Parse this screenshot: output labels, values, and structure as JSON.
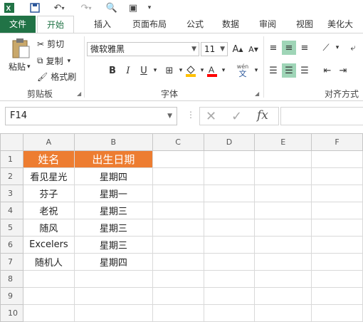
{
  "colors": {
    "accent": "#217346",
    "header_fill": "#ed7d31"
  },
  "tabs": [
    {
      "label": "文件"
    },
    {
      "label": "开始"
    },
    {
      "label": "插入"
    },
    {
      "label": "页面布局"
    },
    {
      "label": "公式"
    },
    {
      "label": "数据"
    },
    {
      "label": "审阅"
    },
    {
      "label": "视图"
    },
    {
      "label": "美化大"
    }
  ],
  "ribbon": {
    "clipboard": {
      "paste": "粘贴",
      "cut": "剪切",
      "copy": "复制",
      "format_painter": "格式刷",
      "group_label": "剪贴板"
    },
    "font": {
      "font_name": "微软雅黑",
      "font_size": "11",
      "bold": "B",
      "italic": "I",
      "underline": "U",
      "wen": "wén",
      "wen_char": "文",
      "group_label": "字体"
    },
    "alignment": {
      "group_label": "对齐方式"
    }
  },
  "formula_bar": {
    "name_box": "F14",
    "fx": "fx",
    "formula": ""
  },
  "sheet": {
    "columns": [
      "A",
      "B",
      "C",
      "D",
      "E",
      "F"
    ],
    "rows": [
      {
        "num": "1",
        "cells": [
          "姓名",
          "出生日期"
        ]
      },
      {
        "num": "2",
        "cells": [
          "看见星光",
          "星期四"
        ]
      },
      {
        "num": "3",
        "cells": [
          "芬子",
          "星期一"
        ]
      },
      {
        "num": "4",
        "cells": [
          "老祝",
          "星期三"
        ]
      },
      {
        "num": "5",
        "cells": [
          "随风",
          "星期三"
        ]
      },
      {
        "num": "6",
        "cells": [
          "Excelers",
          "星期三"
        ]
      },
      {
        "num": "7",
        "cells": [
          "随机人",
          "星期四"
        ]
      },
      {
        "num": "8",
        "cells": [
          "",
          ""
        ]
      },
      {
        "num": "9",
        "cells": [
          "",
          ""
        ]
      },
      {
        "num": "10",
        "cells": [
          "",
          ""
        ]
      }
    ]
  }
}
